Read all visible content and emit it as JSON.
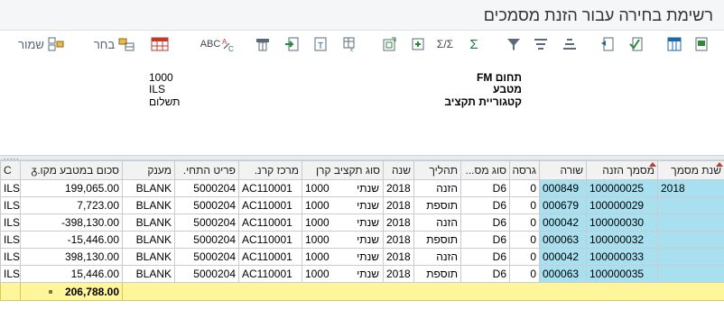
{
  "window": {
    "title": "רשימת בחירה עבור הזנת מסמכים"
  },
  "toolbar": {
    "save_label": "שמור",
    "choose_label": "בחר",
    "spell_label": "ABC",
    "sum_label": "Σ",
    "subtotal_label": "Σ/Σ"
  },
  "header": {
    "fields": [
      {
        "key": "תחום FM",
        "value": "1000"
      },
      {
        "key": "מטבע",
        "value": "ILS"
      },
      {
        "key": "קטגוריית תקציב",
        "value": "תשלום"
      }
    ]
  },
  "splitter": {
    "grip": "....."
  },
  "table": {
    "columns": [
      "C",
      "סכום במטבע מקו.ᵹ",
      "מענק",
      "פריט התחי.",
      "מרכז קרנ.",
      "סוג תקציב קרן",
      "שנה",
      "תהליך",
      "סוג מס...",
      "גרסה",
      "שורה",
      "מסמך הזנה",
      "שנת מסמך"
    ],
    "rows": [
      {
        "c": "ILS",
        "amount": "199,065.00",
        "grant": "BLANK",
        "item": "5000204",
        "center": "AC110001",
        "fund": "1000",
        "budget_type": "שנתי",
        "year": "2018",
        "process": "הזנה",
        "doc_type": "D6",
        "version": "0",
        "line": "000849",
        "doc": "100000025",
        "doc_year": "2018"
      },
      {
        "c": "ILS",
        "amount": "7,723.00",
        "grant": "BLANK",
        "item": "5000204",
        "center": "AC110001",
        "fund": "1000",
        "budget_type": "שנתי",
        "year": "2018",
        "process": "תוספת",
        "doc_type": "D6",
        "version": "0",
        "line": "000679",
        "doc": "100000029",
        "doc_year": ""
      },
      {
        "c": "ILS",
        "amount": "-398,130.00",
        "grant": "BLANK",
        "item": "5000204",
        "center": "AC110001",
        "fund": "1000",
        "budget_type": "שנתי",
        "year": "2018",
        "process": "הזנה",
        "doc_type": "D6",
        "version": "0",
        "line": "000042",
        "doc": "100000030",
        "doc_year": ""
      },
      {
        "c": "ILS",
        "amount": "-15,446.00",
        "grant": "BLANK",
        "item": "5000204",
        "center": "AC110001",
        "fund": "1000",
        "budget_type": "שנתי",
        "year": "2018",
        "process": "תוספת",
        "doc_type": "D6",
        "version": "0",
        "line": "000063",
        "doc": "100000032",
        "doc_year": ""
      },
      {
        "c": "ILS",
        "amount": "398,130.00",
        "grant": "BLANK",
        "item": "5000204",
        "center": "AC110001",
        "fund": "1000",
        "budget_type": "שנתי",
        "year": "2018",
        "process": "הזנה",
        "doc_type": "D6",
        "version": "0",
        "line": "000042",
        "doc": "100000033",
        "doc_year": ""
      },
      {
        "c": "ILS",
        "amount": "15,446.00",
        "grant": "BLANK",
        "item": "5000204",
        "center": "AC110001",
        "fund": "1000",
        "budget_type": "שנתי",
        "year": "2018",
        "process": "תוספת",
        "doc_type": "D6",
        "version": "0",
        "line": "000063",
        "doc": "100000035",
        "doc_year": ""
      }
    ],
    "total": "206,788.00"
  },
  "colors": {
    "key_column": "#a8e0f0",
    "total_row": "#fff59a",
    "sort_marker": "#c0392b"
  }
}
